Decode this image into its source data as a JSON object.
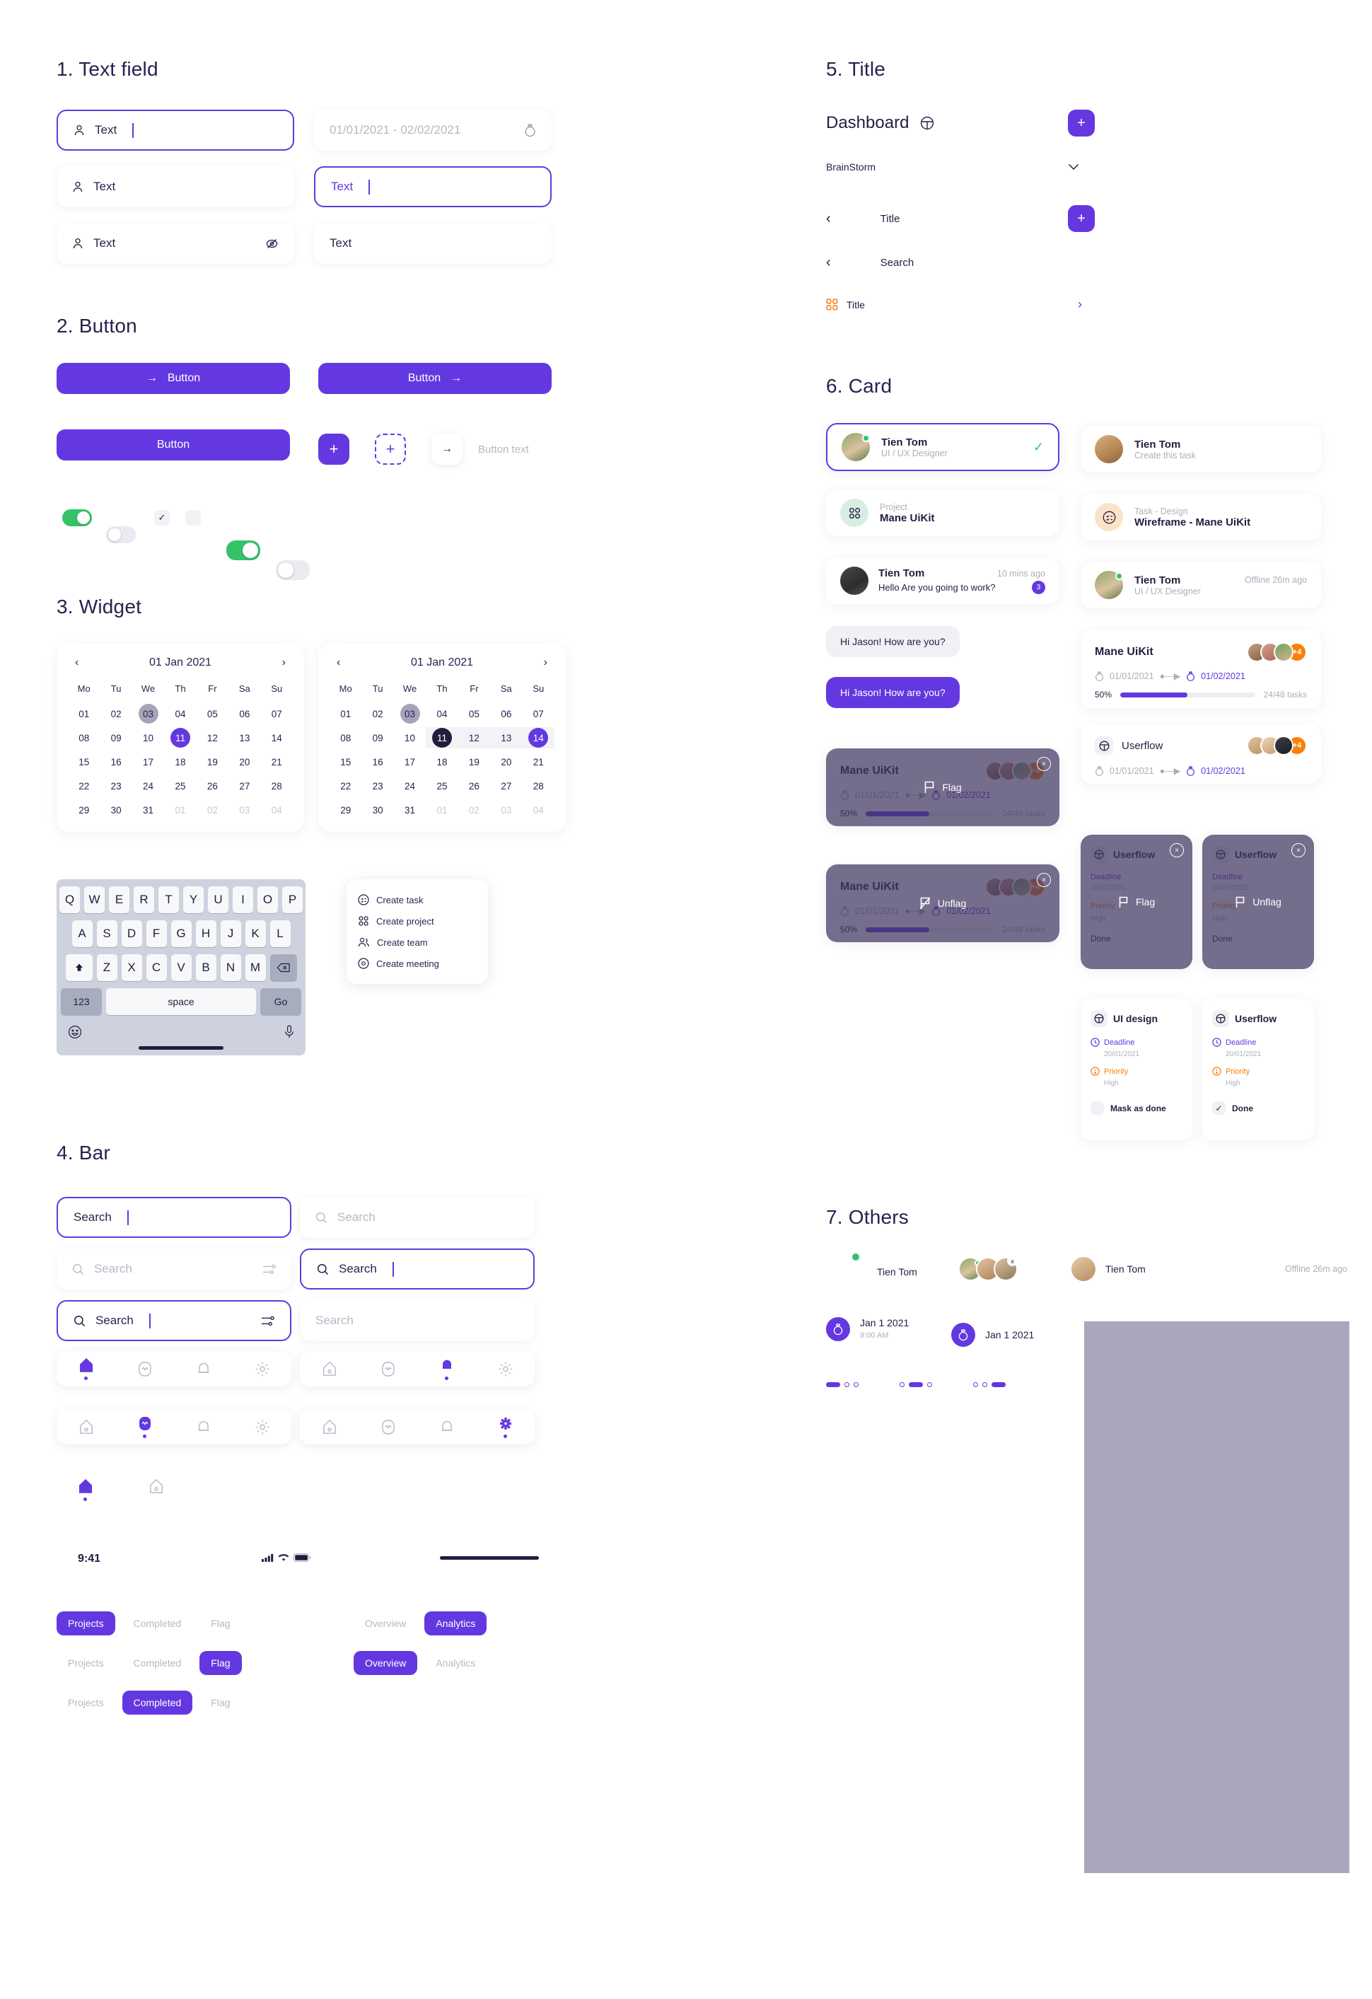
{
  "sections": {
    "s1": "1. Text field",
    "s2": "2. Button",
    "s3": "3. Widget",
    "s4": "4. Bar",
    "s5": "5. Title",
    "s6": "6. Card",
    "s7": "7. Others"
  },
  "textfields": {
    "f1": {
      "value": "Text",
      "icon": "user-icon",
      "state": "focused"
    },
    "f2": {
      "value": "01/01/2021 - 02/02/2021",
      "icon": "timer-icon",
      "state": "placeholder"
    },
    "f3": {
      "value": "Text",
      "icon": "user-icon",
      "state": "default"
    },
    "f4": {
      "value": "Text",
      "state": "focused-accent"
    },
    "f5": {
      "value": "Text",
      "icon": "user-icon",
      "trailing": "eye-off-icon",
      "state": "default"
    },
    "f6": {
      "value": "Text",
      "state": "default"
    }
  },
  "buttons": {
    "b1": "Button",
    "b2": "Button",
    "b3": "Button",
    "plus": "+",
    "plus_dashed": "+",
    "arrow": "→",
    "button_text": "Button text"
  },
  "toggles": [
    {
      "name": "toggle-on-green",
      "state": "on"
    },
    {
      "name": "toggle-off",
      "state": "off"
    },
    {
      "name": "checkbox-checked",
      "state": "checked"
    },
    {
      "name": "checkbox-unchecked",
      "state": "unchecked"
    },
    {
      "name": "toggle-on-green-lg",
      "state": "on"
    },
    {
      "name": "toggle-off-lg",
      "state": "off"
    }
  ],
  "calendar": {
    "title": "01 Jan 2021",
    "prev": "‹",
    "next": "›",
    "dow": [
      "Mo",
      "Tu",
      "We",
      "Th",
      "Fr",
      "Sa",
      "Su"
    ],
    "weeks": [
      [
        "01",
        "02",
        "03",
        "04",
        "05",
        "06",
        "07"
      ],
      [
        "08",
        "09",
        "10",
        "11",
        "12",
        "13",
        "14"
      ],
      [
        "15",
        "16",
        "17",
        "18",
        "19",
        "20",
        "21"
      ],
      [
        "22",
        "23",
        "24",
        "25",
        "26",
        "27",
        "28"
      ],
      [
        "29",
        "30",
        "31",
        "01",
        "02",
        "03",
        "04"
      ]
    ],
    "today": "03",
    "selected_single": "11",
    "range_start": "11",
    "range_end": "14"
  },
  "keyboard": {
    "row1": [
      "Q",
      "W",
      "E",
      "R",
      "T",
      "Y",
      "U",
      "I",
      "O",
      "P"
    ],
    "row2": [
      "A",
      "S",
      "D",
      "F",
      "G",
      "H",
      "J",
      "K",
      "L"
    ],
    "row3": [
      "Z",
      "X",
      "C",
      "V",
      "B",
      "N",
      "M"
    ],
    "shift": "shift-icon",
    "backspace": "backspace-icon",
    "num": "123",
    "space": "space",
    "go": "Go",
    "emoji": "emoji-icon",
    "mic": "microphone-icon"
  },
  "menu": [
    {
      "label": "Create task",
      "icon": "task-icon"
    },
    {
      "label": "Create project",
      "icon": "grid-icon"
    },
    {
      "label": "Create team",
      "icon": "team-icon"
    },
    {
      "label": "Create meeting",
      "icon": "meeting-icon"
    }
  ],
  "searchbars": {
    "s1": {
      "value": "Search",
      "state": "focused",
      "icon": false,
      "filter": false
    },
    "s2": {
      "value": "Search",
      "state": "placeholder",
      "icon": true,
      "filter": false
    },
    "s3": {
      "value": "Search",
      "state": "placeholder",
      "icon": true,
      "filter": true
    },
    "s4": {
      "value": "Search",
      "state": "focused",
      "icon": true,
      "filter": false
    },
    "s5": {
      "value": "Search",
      "state": "focused",
      "icon": true,
      "filter": true
    },
    "s6": {
      "value": "Search",
      "state": "placeholder",
      "icon": false,
      "filter": false
    }
  },
  "tabbars": [
    {
      "icons": [
        "home-icon",
        "activity-icon",
        "bell-icon",
        "gear-icon"
      ],
      "active": 0
    },
    {
      "icons": [
        "home-icon",
        "activity-icon",
        "bell-icon",
        "gear-icon"
      ],
      "active": 2
    },
    {
      "icons": [
        "home-icon",
        "activity-icon",
        "bell-icon",
        "gear-icon"
      ],
      "active": 1
    },
    {
      "icons": [
        "home-icon",
        "activity-icon",
        "bell-icon",
        "gear-icon"
      ],
      "active": 3
    }
  ],
  "statusbar": {
    "time": "9:41",
    "icons": [
      "cellular-icon",
      "wifi-icon",
      "battery-icon"
    ]
  },
  "chiprows": [
    {
      "items": [
        "Projects",
        "Completed",
        "Flag"
      ],
      "active": 0
    },
    {
      "items": [
        "Projects",
        "Completed",
        "Flag"
      ],
      "active": 2
    },
    {
      "items": [
        "Projects",
        "Completed",
        "Flag"
      ],
      "active": 1
    }
  ],
  "chiprows_right": [
    {
      "items": [
        "Overview",
        "Analytics"
      ],
      "active": 1
    },
    {
      "items": [
        "Overview",
        "Analytics"
      ],
      "active": 0
    }
  ],
  "title": {
    "dashboard": "Dashboard",
    "dashboard_icon": "userflow-icon",
    "plus": "+",
    "brainstorm": "BrainStorm",
    "chevron_down": "⌄",
    "back": "‹",
    "nav_title": "Title",
    "nav_search": "Search",
    "list_title": "Title",
    "list_icon": "grid-icon-orange",
    "chevron_right": "›"
  },
  "cards": {
    "person_selected": {
      "name": "Tien Tom",
      "role": "UI / UX Designer",
      "check": "✓",
      "online": true
    },
    "person_task": {
      "name": "Tien Tom",
      "role": "Create this task"
    },
    "project": {
      "label": "Project",
      "title": "Mane UiKit",
      "icon": "grid-icon"
    },
    "task": {
      "label": "Task - Design",
      "title": "Wireframe - Mane UiKit",
      "icon": "task-icon"
    },
    "message": {
      "name": "Tien Tom",
      "time": "10 mins ago",
      "text": "Hello Are you going to work?",
      "badge": "3"
    },
    "person_offline": {
      "name": "Tien Tom",
      "role": "UI / UX Designer",
      "status": "Offline 26m ago",
      "online": true
    },
    "bubble_in": "Hi Jason! How are you?",
    "bubble_out": "Hi Jason! How are you?",
    "project_card": {
      "title": "Mane UiKit",
      "plus": "+4",
      "date_start": "01/01/2021",
      "date_end": "01/02/2021",
      "percent": "50%",
      "tasks": "24/48 tasks",
      "tasks_done": "24",
      "tasks_total": "/48 tasks",
      "progress": 50
    },
    "userflow_card": {
      "title": "Userflow",
      "plus": "+4",
      "date_start": "01/01/2021",
      "date_end": "01/02/2021",
      "icon": "userflow-icon"
    },
    "overlay_flag": {
      "label": "Flag",
      "icon": "flag-icon",
      "close": "×"
    },
    "overlay_unflag": {
      "label": "Unflag",
      "icon": "flag-off-icon",
      "close": "×"
    },
    "detail_left": {
      "title": "UI design",
      "icon": "userflow-icon",
      "deadline_label": "Deadline",
      "deadline_value": "20/01/2021",
      "priority_label": "Priority",
      "priority_value": "High",
      "done_label": "Mask as done",
      "done": false
    },
    "detail_right": {
      "title": "Userflow",
      "icon": "userflow-icon",
      "deadline_label": "Deadline",
      "deadline_value": "20/01/2021",
      "priority_label": "Priority",
      "priority_value": "High",
      "done_label": "Done",
      "done": true
    },
    "overlay_small_flag": {
      "title": "Userflow",
      "label": "Flag"
    },
    "overlay_small_unflag": {
      "title": "Userflow",
      "label": "Unflag"
    }
  },
  "others": {
    "avatar_name": "Tien Tom",
    "avatar_name2": "Tien Tom",
    "offline": "Offline 26m ago",
    "remove": "x",
    "date1": {
      "date": "Jan 1 2021",
      "time": "9:00 AM",
      "icon": "timer-icon"
    },
    "date2": {
      "date": "Jan 1 2021",
      "icon": "timer-icon"
    },
    "pagination": [
      {
        "active": 0,
        "count": 3
      },
      {
        "active": 1,
        "count": 3
      },
      {
        "active": 2,
        "count": 3
      }
    ]
  },
  "colors": {
    "accent": "#6438e0",
    "green": "#35c36a",
    "orange": "#f98107",
    "dark": "#241c3f",
    "muted": "#b0adbd"
  }
}
